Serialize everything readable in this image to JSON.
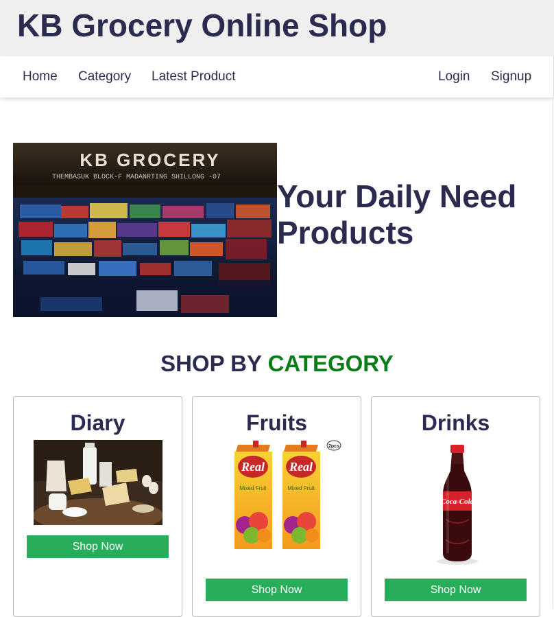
{
  "header": {
    "title": "KB Grocery Online Shop"
  },
  "nav": {
    "left": [
      "Home",
      "Category",
      "Latest Product"
    ],
    "right": [
      "Login",
      "Signup"
    ]
  },
  "hero": {
    "sign_text": "KB GROCERY",
    "sign_subtext": "THEMBASUK BLOCK-F MADANRTING SHILLONG -07",
    "heading": "Your Daily Need Products"
  },
  "section": {
    "title_part1": "SHOP BY",
    "title_part2": "CATEGORY"
  },
  "cards": [
    {
      "title": "Diary",
      "button": "Shop Now"
    },
    {
      "title": "Fruits",
      "button": "Shop Now",
      "pack_brand": "Real",
      "pack_sub": "fruit power",
      "pack_label": "Mixed Fruit",
      "badge": "2pcs"
    },
    {
      "title": "Drinks",
      "button": "Shop Now",
      "label": "Coca-Cola"
    }
  ],
  "colors": {
    "primary_text": "#2b2b4f",
    "accent_green": "#0b7d16",
    "button_green": "#28ad5a",
    "header_bg": "#efefef"
  }
}
